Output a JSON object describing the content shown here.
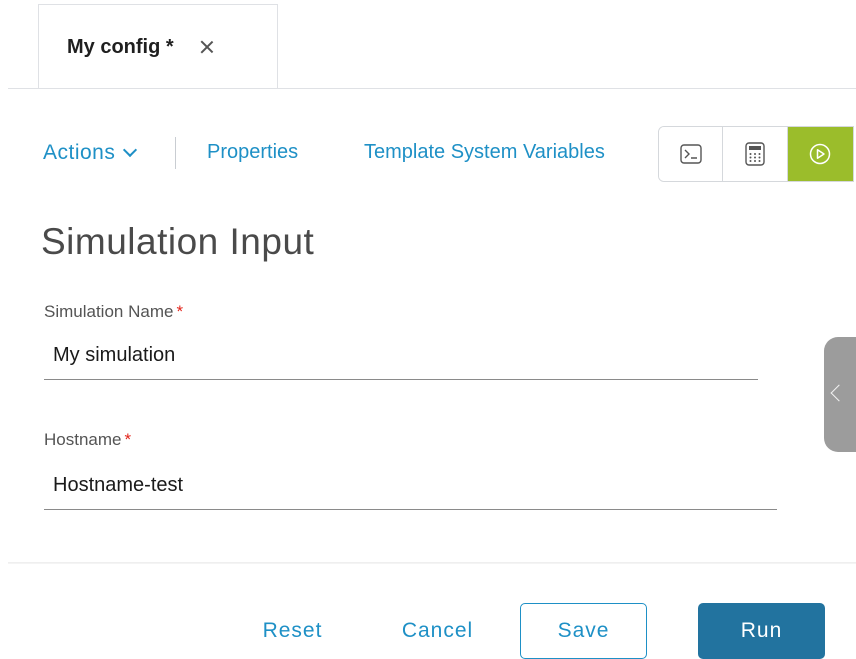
{
  "tab": {
    "title": "My config *"
  },
  "toolbar": {
    "actions_label": "Actions",
    "properties_label": "Properties",
    "template_variables_label": "Template System Variables",
    "icon_buttons": [
      "terminal-icon",
      "calculator-icon",
      "play-circle-icon"
    ],
    "accent_color": "#9bbd2b"
  },
  "form": {
    "heading": "Simulation Input",
    "fields": [
      {
        "label": "Simulation Name",
        "required_mark": "*",
        "value": "My simulation"
      },
      {
        "label": "Hostname",
        "required_mark": "*",
        "value": "Hostname-test"
      }
    ]
  },
  "footer": {
    "reset_label": "Reset",
    "cancel_label": "Cancel",
    "save_label": "Save",
    "run_label": "Run",
    "primary_color": "#22739f",
    "link_color": "#1e90c6"
  }
}
